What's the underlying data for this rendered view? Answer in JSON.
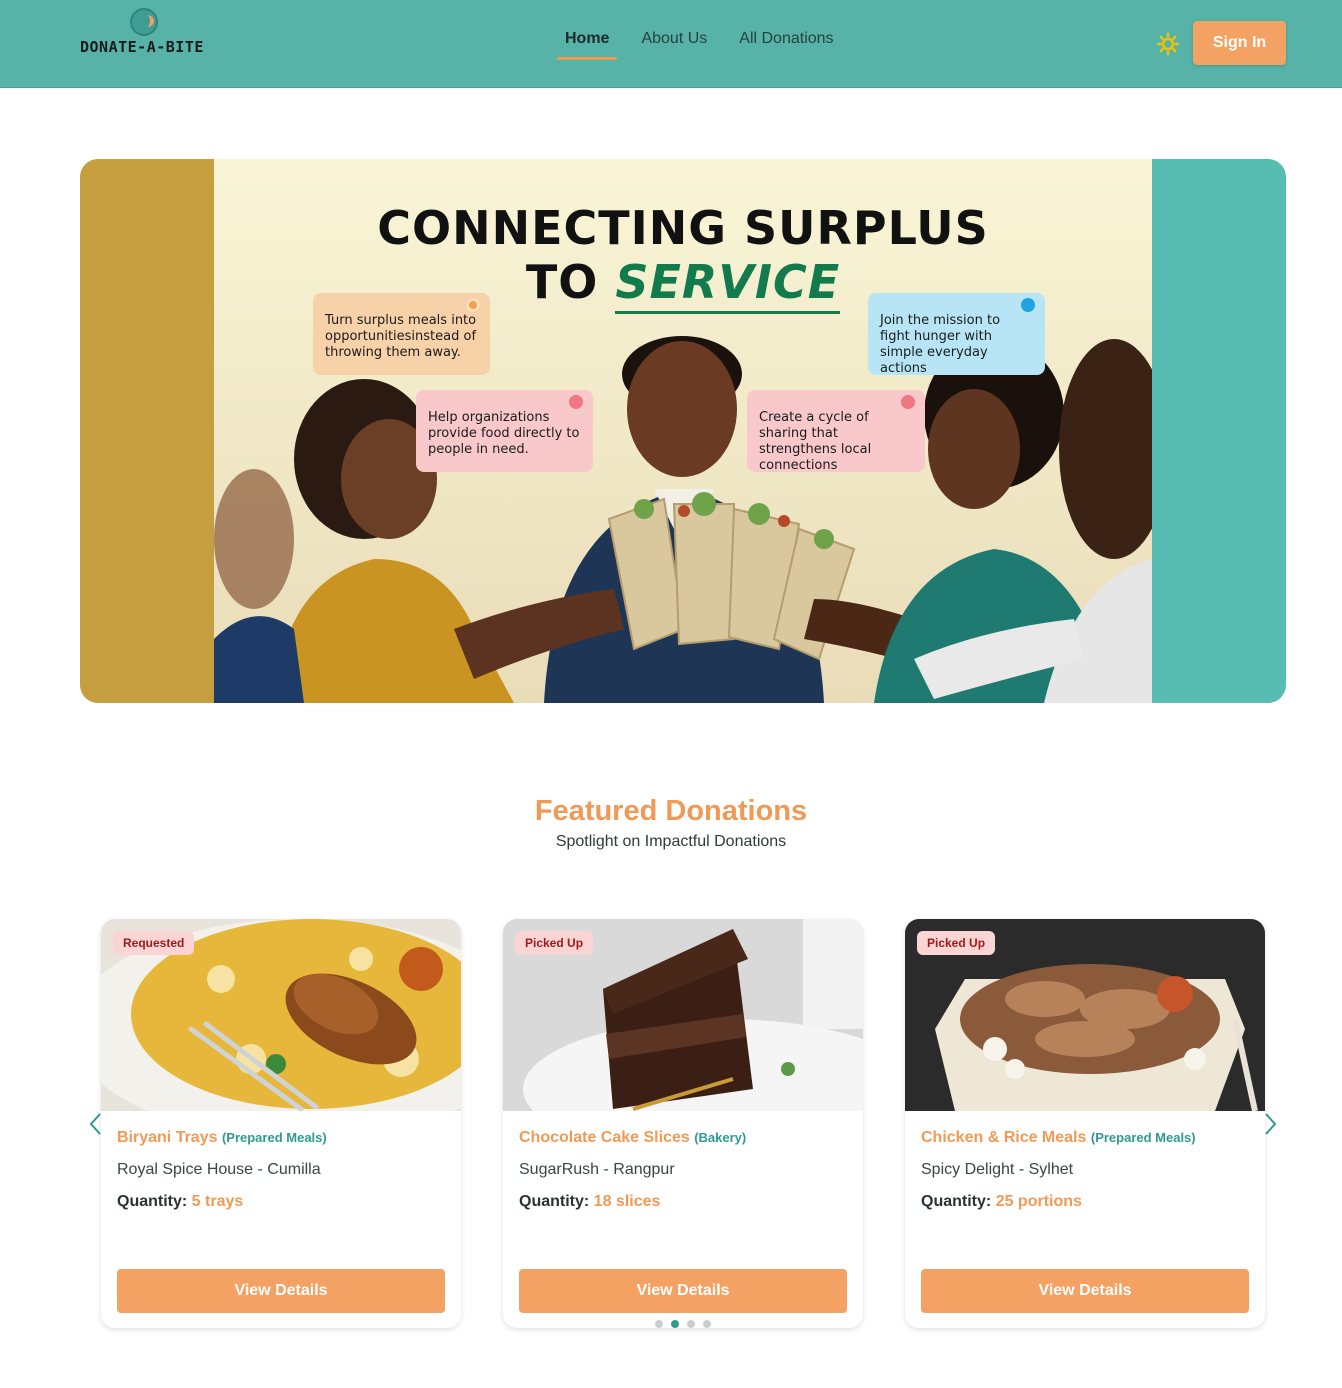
{
  "brand": {
    "name": "DONATE-A-BITE",
    "accent": "#f19a56",
    "primary": "#57b2a8"
  },
  "nav": {
    "links": [
      {
        "label": "Home",
        "active": true
      },
      {
        "label": "About Us",
        "active": false
      },
      {
        "label": "All Donations",
        "active": false
      }
    ],
    "theme_icon": "sun-icon",
    "signin_label": "Sign In"
  },
  "hero": {
    "title_line1": "CONNECTING SURPLUS",
    "title_line2_prefix": "TO",
    "title_line2_accent": "SERVICE",
    "callouts": [
      {
        "text": "Turn surplus meals into opportunitiesinstead of throwing them away."
      },
      {
        "text": "Help organizations provide food directly to people in need."
      },
      {
        "text": "Create a cycle of sharing that strengthens local connections"
      },
      {
        "text": "Join the mission to fight hunger with simple everyday actions"
      }
    ]
  },
  "featured": {
    "title": "Featured Donations",
    "subtitle": "Spotlight on Impactful Donations",
    "cards": [
      {
        "status": "Requested",
        "name": "Biryani Trays",
        "category": "(Prepared Meals)",
        "location": "Royal Spice House - Cumilla",
        "quantity_label": "Quantity:",
        "quantity": "5 trays",
        "button": "View Details"
      },
      {
        "status": "Picked Up",
        "name": "Chocolate Cake Slices",
        "category": "(Bakery)",
        "location": "SugarRush - Rangpur",
        "quantity_label": "Quantity:",
        "quantity": "18 slices",
        "button": "View Details"
      },
      {
        "status": "Picked Up",
        "name": "Chicken & Rice Meals",
        "category": "(Prepared Meals)",
        "location": "Spicy Delight - Sylhet",
        "quantity_label": "Quantity:",
        "quantity": "25 portions",
        "button": "View Details"
      }
    ],
    "pagination": {
      "total": 4,
      "active_index": 1
    }
  }
}
